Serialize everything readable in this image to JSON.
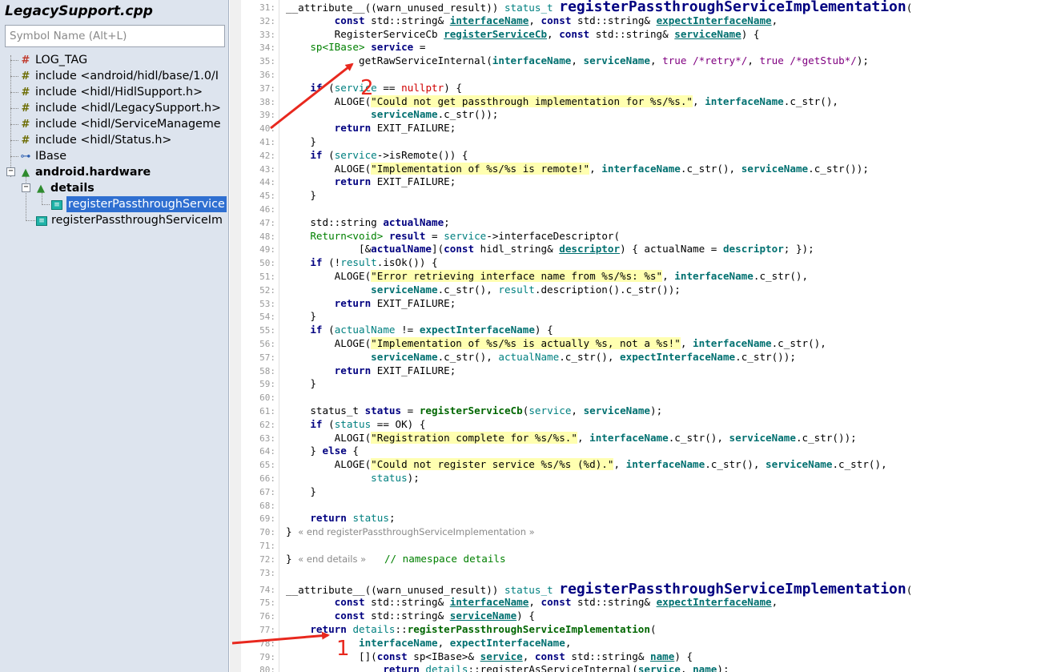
{
  "sidebar": {
    "file_title": "LegacySupport.cpp",
    "search_placeholder": "Symbol Name (Alt+L)",
    "items": [
      {
        "icon": "macro-icon",
        "label": "LOG_TAG"
      },
      {
        "icon": "include-icon",
        "label": "include <android/hidl/base/1.0/I"
      },
      {
        "icon": "include-icon",
        "label": "include <hidl/HidlSupport.h>"
      },
      {
        "icon": "include-icon",
        "label": "include <hidl/LegacySupport.h>"
      },
      {
        "icon": "include-icon",
        "label": "include <hidl/ServiceManageme"
      },
      {
        "icon": "include-icon",
        "label": "include <hidl/Status.h>"
      },
      {
        "icon": "using-icon",
        "label": "IBase"
      },
      {
        "icon": "namespace-icon",
        "label": "android.hardware"
      },
      {
        "icon": "namespace-icon",
        "label": "details"
      },
      {
        "icon": "function-icon",
        "label": "registerPassthroughService"
      },
      {
        "icon": "function-icon",
        "label": "registerPassthroughServiceIm"
      }
    ]
  },
  "editor": {
    "line_numbers": [
      "31:",
      "32:",
      "33:",
      "34:",
      "35:",
      "36:",
      "37:",
      "38:",
      "39:",
      "40:",
      "41:",
      "42:",
      "43:",
      "44:",
      "45:",
      "46:",
      "47:",
      "48:",
      "49:",
      "50:",
      "51:",
      "52:",
      "53:",
      "54:",
      "55:",
      "56:",
      "57:",
      "58:",
      "59:",
      "60:",
      "61:",
      "62:",
      "63:",
      "64:",
      "65:",
      "66:",
      "67:",
      "68:",
      "69:",
      "70:",
      "71:",
      "72:",
      "73:",
      "74:",
      "75:",
      "76:",
      "77:",
      "78:",
      "79:",
      "80:"
    ],
    "fold_labels": {
      "end_fn": "« end registerPassthroughServiceImplementation »",
      "end_details": "« end details »",
      "ns_comment": "// namespace details"
    }
  },
  "annotations": {
    "arrow1_label": "1",
    "arrow2_label": "2",
    "arrow_color": "#e8281e"
  }
}
